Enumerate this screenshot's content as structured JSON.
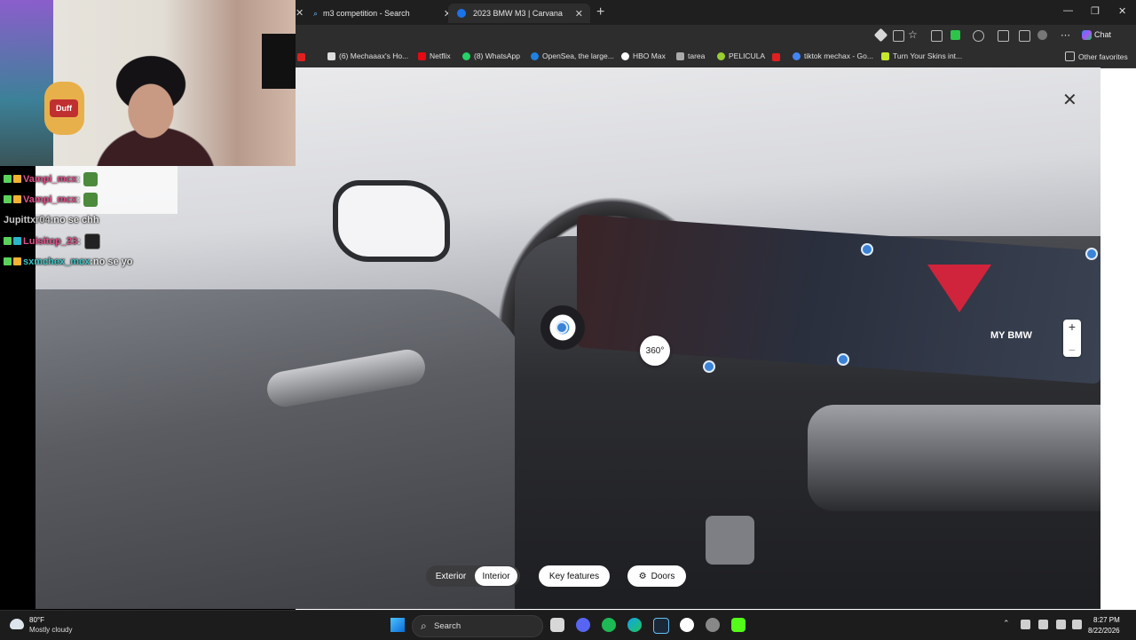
{
  "browser": {
    "tabs": [
      {
        "title": "m3 competition - Search",
        "active": false
      },
      {
        "title": "2023 BMW M3 | Carvana",
        "active": true
      }
    ],
    "new_tab_symbol": "+",
    "chat_label": "Chat",
    "bookmarks": [
      {
        "label": "(6) Mechaaax's Ho...",
        "icon": "x-icon"
      },
      {
        "label": "Netflix",
        "icon": "netflix-icon"
      },
      {
        "label": "(8) WhatsApp",
        "icon": "whatsapp-icon"
      },
      {
        "label": "OpenSea, the large...",
        "icon": "opensea-icon"
      },
      {
        "label": "HBO Max",
        "icon": "hbo-icon"
      },
      {
        "label": "tarea",
        "icon": "tarea-icon"
      },
      {
        "label": "PELICULA",
        "icon": "pelicula-icon"
      },
      {
        "label": "tiktok mechax - Go...",
        "icon": "tiktok-icon"
      },
      {
        "label": "Turn Your Skins int...",
        "icon": "skins-icon"
      }
    ],
    "other_favorites": "Other favorites"
  },
  "viewer": {
    "badge_360": "360°",
    "close_symbol": "✕",
    "zoom_in": "+",
    "zoom_out": "−",
    "dashboard_text": "MY BMW",
    "controls": {
      "exterior": "Exterior",
      "interior": "Interior",
      "selected": "Interior",
      "key_features": "Key features",
      "doors": "Doors"
    }
  },
  "chat": {
    "messages": [
      {
        "user": "Vampi_mcx",
        "sep": " :",
        "text": "",
        "color": "#e0508a",
        "has_emote": true
      },
      {
        "user": "Vampi_mcx",
        "sep": " :",
        "text": "",
        "color": "#e0508a",
        "has_emote": true
      },
      {
        "user": "Jupittxr04",
        "sep": " :",
        "text": " no se chh",
        "color": "#c8c8c8",
        "has_emote": false
      },
      {
        "user": "Luisitop_23",
        "sep": " :",
        "text": "",
        "color": "#e0508a",
        "has_emote": true
      },
      {
        "user": "sxmchex_mcx",
        "sep": " :",
        "text": " no se yo",
        "color": "#39c4c4",
        "has_emote": false
      }
    ]
  },
  "taskbar": {
    "weather_temp": "80°F",
    "weather_desc": "Mostly cloudy",
    "search_label": "Search",
    "time": "8:27 PM",
    "date": "8/22/2026"
  },
  "colors": {
    "browser_bg": "#1f1f1f",
    "taskbar_bg": "#1c1c1c",
    "hotspot": "#3a83d6",
    "accent_red": "#d0243c"
  }
}
